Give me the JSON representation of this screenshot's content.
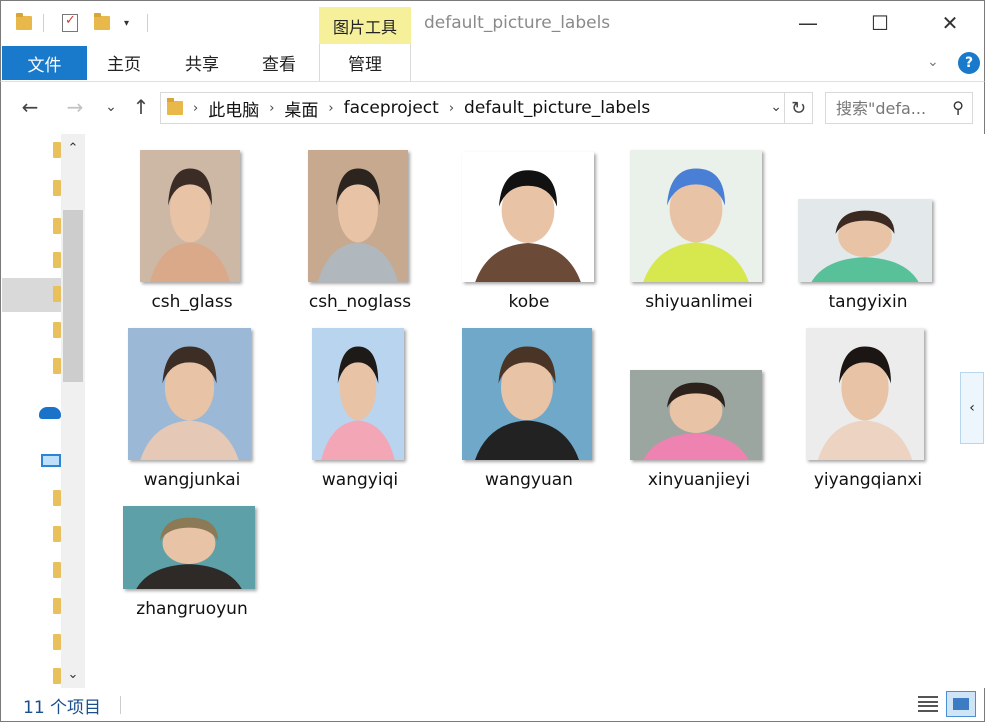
{
  "titlebar": {
    "context_tab": "图片工具",
    "title": "default_picture_labels",
    "minimize": "—",
    "maximize": "☐",
    "close": "✕"
  },
  "ribbon": {
    "tabs": [
      "文件",
      "主页",
      "共享",
      "查看",
      "管理"
    ],
    "help": "?"
  },
  "address": {
    "back": "←",
    "forward": "→",
    "recent": "⌄",
    "up": "↑",
    "crumbs": [
      "此电脑",
      "桌面",
      "faceproject",
      "default_picture_labels"
    ],
    "separator": "›",
    "refresh": "↻",
    "search_placeholder": "搜索\"defa..."
  },
  "files": [
    {
      "name": "csh_glass",
      "thumb_colors": [
        "#cdb8a5",
        "#3b2c25",
        "#d9a98a"
      ]
    },
    {
      "name": "csh_noglass",
      "thumb_colors": [
        "#c7a98f",
        "#2c241f",
        "#b0b7bd"
      ]
    },
    {
      "name": "kobe",
      "thumb_colors": [
        "#ffffff",
        "#111111",
        "#6b4a38"
      ]
    },
    {
      "name": "shiyuanlimei",
      "thumb_colors": [
        "#e9f1ea",
        "#4a7fd6",
        "#d6e84e"
      ]
    },
    {
      "name": "tangyixin",
      "thumb_colors": [
        "#e3e9ea",
        "#3b2a22",
        "#59c199"
      ]
    },
    {
      "name": "wangjunkai",
      "thumb_colors": [
        "#9bb9d6",
        "#3c2d25",
        "#e6c8b6"
      ]
    },
    {
      "name": "wangyiqi",
      "thumb_colors": [
        "#b9d4ef",
        "#1d1a18",
        "#f3a6b6"
      ]
    },
    {
      "name": "wangyuan",
      "thumb_colors": [
        "#6fa8c9",
        "#4a3426",
        "#222222"
      ]
    },
    {
      "name": "xinyuanjieyi",
      "thumb_colors": [
        "#9aa69f",
        "#2d211c",
        "#ee82b0"
      ]
    },
    {
      "name": "yiyangqianxi",
      "thumb_colors": [
        "#ececec",
        "#1b1614",
        "#ecd3c2"
      ]
    },
    {
      "name": "zhangruoyun",
      "thumb_colors": [
        "#5ea0a7",
        "#8b7a55",
        "#2e2a28"
      ]
    }
  ],
  "status": {
    "count": "11 个项目"
  },
  "icons": {
    "pane_toggle": "‹",
    "scroll_up": "⌃",
    "scroll_down": "⌄",
    "ribbon_collapse": "⌄",
    "search": "⚲"
  }
}
